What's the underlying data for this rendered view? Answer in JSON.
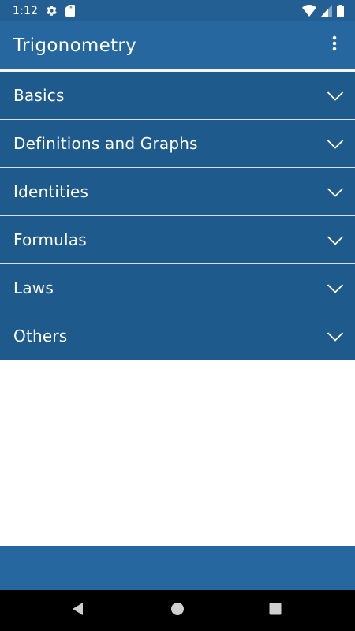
{
  "status_bar": {
    "time": "1:12",
    "icons": [
      "settings-gear-icon",
      "sd-card-icon",
      "wifi-icon",
      "cell-signal-icon",
      "battery-icon"
    ]
  },
  "app_bar": {
    "title": "Trigonometry",
    "overflow_icon": "more-vert-icon"
  },
  "menu": {
    "items": [
      {
        "label": "Basics",
        "icon": "chevron-down-icon"
      },
      {
        "label": "Definitions and Graphs",
        "icon": "chevron-down-icon"
      },
      {
        "label": "Identities",
        "icon": "chevron-down-icon"
      },
      {
        "label": "Formulas",
        "icon": "chevron-down-icon"
      },
      {
        "label": "Laws",
        "icon": "chevron-down-icon"
      },
      {
        "label": "Others",
        "icon": "chevron-down-icon"
      }
    ]
  },
  "nav_bar": {
    "buttons": [
      "back-icon",
      "home-icon",
      "recents-icon"
    ]
  },
  "colors": {
    "status_bar": "#245f94",
    "app_bar": "#2767a0",
    "menu_item": "#1f5a8d",
    "nav_bar": "#000000",
    "text": "#ffffff"
  }
}
